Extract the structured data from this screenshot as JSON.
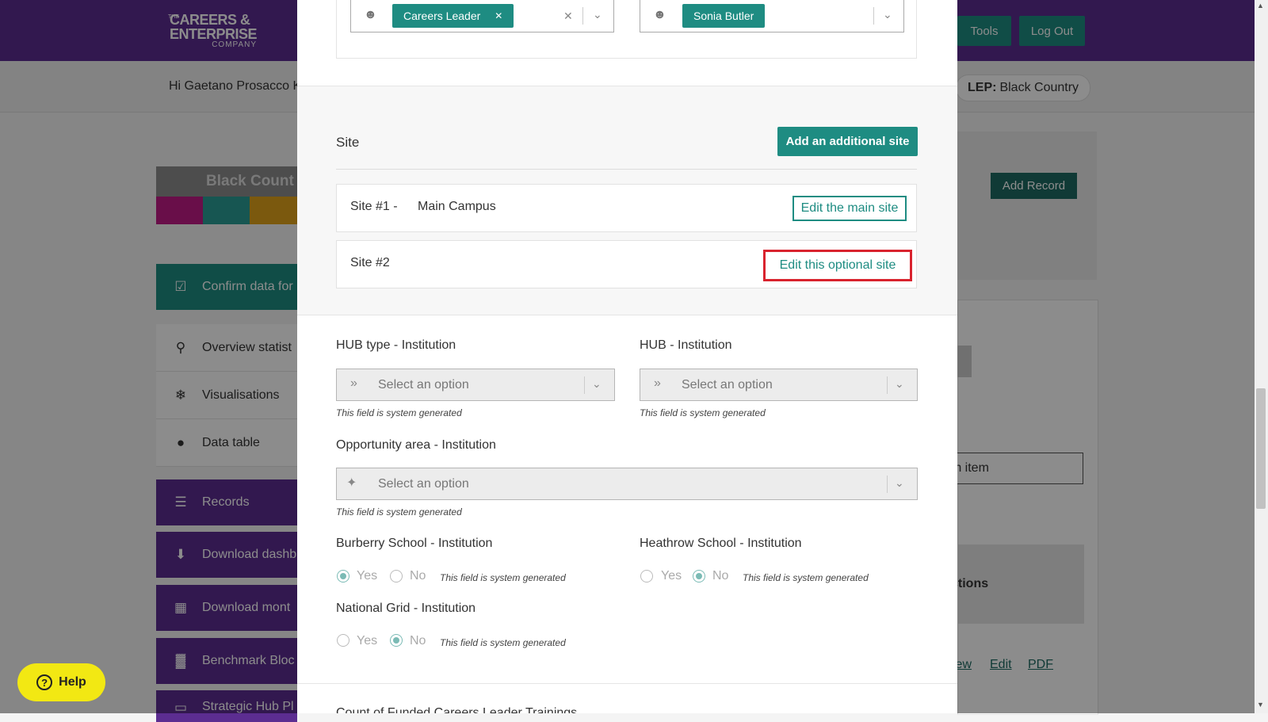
{
  "header": {
    "logo_small": "THE",
    "logo_line1": "CAREERS &",
    "logo_line2": "ENTERPRISE",
    "logo_line3": "COMPANY",
    "tools_label": "Tools",
    "logout_label": "Log Out"
  },
  "greeting": "Hi Gaetano Prosacco K",
  "lep": {
    "label": "LEP:",
    "value": "Black Country"
  },
  "sidebar": {
    "banner_title": "Black Count",
    "stripe_colors": [
      "#c01b86",
      "#2a9d96",
      "#e0a21a"
    ],
    "items": [
      {
        "label": "Confirm data for",
        "icon": "calendar-check-icon"
      },
      {
        "label": "Overview statist",
        "icon": "search-chart-icon"
      },
      {
        "label": "Visualisations",
        "icon": "chart-icon"
      },
      {
        "label": "Data table",
        "icon": "person-icon"
      },
      {
        "label": "Records",
        "icon": "list-icon"
      },
      {
        "label": "Download dashb",
        "icon": "download-icon"
      },
      {
        "label": "Download mont",
        "icon": "calendar-icon"
      },
      {
        "label": "Benchmark Bloc",
        "icon": "bar-chart-icon"
      },
      {
        "label": "Strategic Hub Pl",
        "icon": "window-icon"
      }
    ]
  },
  "right_panel": {
    "add_record": "Add Record",
    "search_placeholder": "rch item",
    "actions_heading": "ctions",
    "links": [
      "iew",
      "Edit",
      "PDF"
    ]
  },
  "help": {
    "label": "Help"
  },
  "modal": {
    "contacts": {
      "left_tag": "Careers Leader",
      "right_tag": "Sonia Butler"
    },
    "site_section": {
      "title": "Site",
      "add_button": "Add an additional site",
      "sites": [
        {
          "label": "Site #1 -",
          "name": "Main Campus",
          "button": "Edit the main site"
        },
        {
          "label": "Site #2",
          "name": "",
          "button": "Edit this optional site"
        }
      ]
    },
    "fields": {
      "hub_type": {
        "label": "HUB type - Institution",
        "placeholder": "Select an option",
        "hint": "This field is system generated"
      },
      "hub": {
        "label": "HUB - Institution",
        "placeholder": "Select an option",
        "hint": "This field is system generated"
      },
      "opportunity": {
        "label": "Opportunity area - Institution",
        "placeholder": "Select an option",
        "hint": "This field is system generated"
      },
      "burberry": {
        "label": "Burberry School - Institution",
        "yes": "Yes",
        "no": "No",
        "selected": "Yes",
        "hint": "This field is system generated"
      },
      "heathrow": {
        "label": "Heathrow School - Institution",
        "yes": "Yes",
        "no": "No",
        "selected": "No",
        "hint": "This field is system generated"
      },
      "national_grid": {
        "label": "National Grid - Institution",
        "yes": "Yes",
        "no": "No",
        "selected": "No",
        "hint": "This field is system generated"
      }
    },
    "cut_off_label": "Count of Funded Careers Leader Trainings"
  },
  "colors": {
    "purple": "#5c2d91",
    "teal": "#1e8c82",
    "highlight": "#d9232e",
    "help_yellow": "#f2e813"
  }
}
